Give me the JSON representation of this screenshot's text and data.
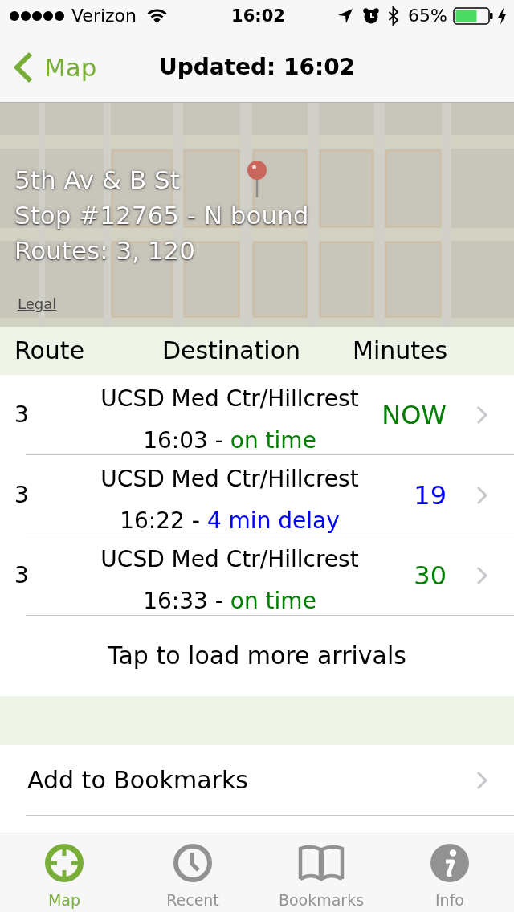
{
  "status_bar": {
    "carrier": "Verizon",
    "time": "16:02",
    "battery": "65%"
  },
  "nav_bar": {
    "back": "Map",
    "title": "Updated: 16:02"
  },
  "stop": {
    "name": "5th Av & B St",
    "number": "Stop #12765 - N bound",
    "routes": "Routes: 3, 120",
    "legal": "Legal"
  },
  "table": {
    "columns": [
      "Route",
      "Destination",
      "Minutes"
    ],
    "arrivals": [
      {
        "route": "3",
        "destination": "UCSD Med Ctr/Hillcrest",
        "time": "16:03 -",
        "status": "on time",
        "minutes": "NOW",
        "color": "#008000"
      },
      {
        "route": "3",
        "destination": "UCSD Med Ctr/Hillcrest",
        "time": "16:22 -",
        "status": "4 min delay",
        "minutes": "19",
        "color": "#0000ff"
      },
      {
        "route": "3",
        "destination": "UCSD Med Ctr/Hillcrest",
        "time": "16:33 -",
        "status": "on time",
        "minutes": "30",
        "color": "#008000"
      }
    ],
    "load_more": "Tap to load more arrivals"
  },
  "actions": [
    {
      "label": "Add to Bookmarks"
    }
  ],
  "tab_bar": [
    {
      "label": "Map",
      "selected": true
    },
    {
      "label": "Recent",
      "selected": false
    },
    {
      "label": "Bookmarks",
      "selected": false
    },
    {
      "label": "Info",
      "selected": false
    }
  ]
}
